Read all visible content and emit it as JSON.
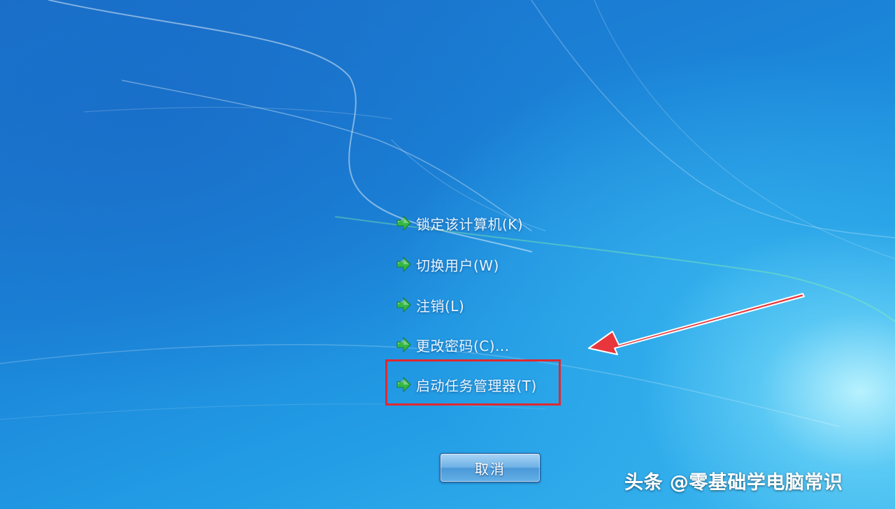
{
  "menu": {
    "items": [
      {
        "label": "锁定该计算机(K)",
        "icon": "green-arrow-icon"
      },
      {
        "label": "切换用户(W)",
        "icon": "green-arrow-icon"
      },
      {
        "label": "注销(L)",
        "icon": "green-arrow-icon"
      },
      {
        "label": "更改密码(C)...",
        "icon": "green-arrow-icon"
      },
      {
        "label": "启动任务管理器(T)",
        "icon": "green-arrow-icon"
      }
    ]
  },
  "cancel_button": {
    "label": "取消"
  },
  "watermark": {
    "text": "头条 @零基础学电脑常识"
  },
  "colors": {
    "background": "#1b84d8",
    "highlight_box": "#e0282f",
    "annotation_arrow": "#e8363c",
    "option_icon": "#34b944"
  }
}
